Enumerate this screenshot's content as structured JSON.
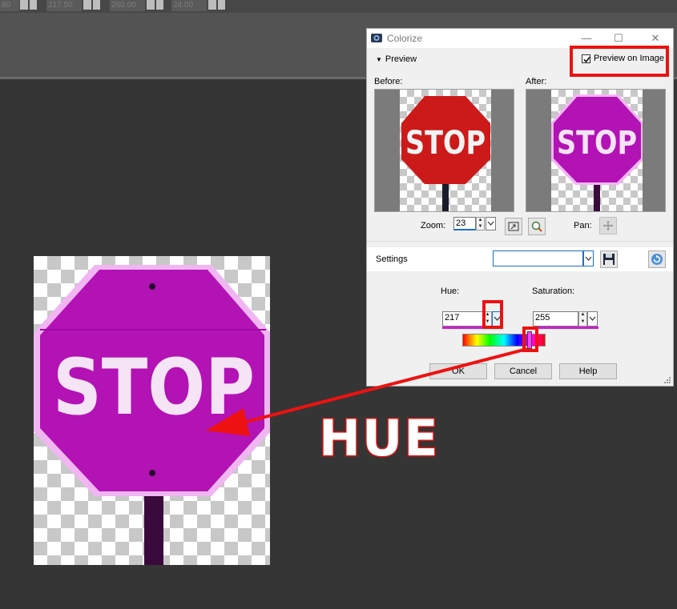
{
  "toolbar": {
    "fields": [
      "80",
      "217.50",
      "260.00",
      "24.00"
    ]
  },
  "dialog": {
    "title": "Colorize",
    "window_buttons": {
      "minimize": "—",
      "maximize": "☐",
      "close": "✕"
    },
    "preview_toggle": "Preview",
    "preview_on_image": {
      "label": "Preview on Image",
      "checked": true
    },
    "before_label": "Before:",
    "after_label": "After:",
    "zoom": {
      "label": "Zoom:",
      "value": "23"
    },
    "pan_label": "Pan:",
    "settings": {
      "label": "Settings",
      "value": ""
    },
    "hue": {
      "label": "Hue:",
      "value": "217"
    },
    "saturation": {
      "label": "Saturation:",
      "value": "255"
    },
    "buttons": {
      "ok": "OK",
      "cancel": "Cancel",
      "help": "Help"
    }
  },
  "sign_text": "STOP",
  "annotation": {
    "text": "HUE",
    "color": "#dd1111"
  },
  "colors": {
    "magenta": "#b010b8",
    "red_sign": "#cc1a1a",
    "highlight": "#ee1111"
  }
}
